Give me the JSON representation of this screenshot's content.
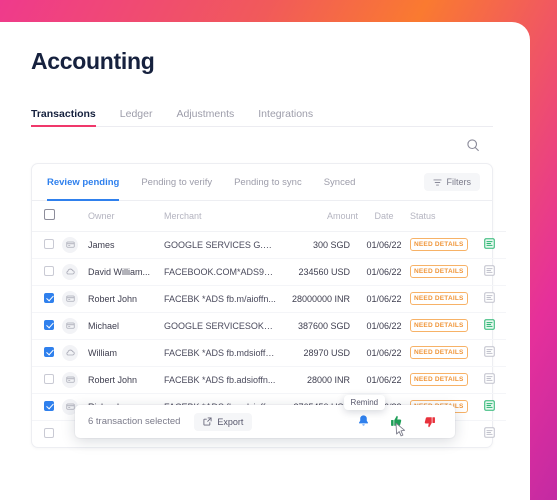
{
  "page": {
    "title": "Accounting"
  },
  "nav_tabs": [
    {
      "label": "Transactions",
      "active": true
    },
    {
      "label": "Ledger",
      "active": false
    },
    {
      "label": "Adjustments",
      "active": false
    },
    {
      "label": "Integrations",
      "active": false
    }
  ],
  "search": {
    "icon": "search-icon"
  },
  "card_tabs": [
    {
      "label": "Review pending",
      "active": true
    },
    {
      "label": "Pending to verify",
      "active": false
    },
    {
      "label": "Pending to sync",
      "active": false
    },
    {
      "label": "Synced",
      "active": false
    }
  ],
  "filters": {
    "label": "Filters",
    "icon": "filter-icon"
  },
  "table": {
    "columns": [
      "",
      "",
      "Owner",
      "Merchant",
      "Amount",
      "Date",
      "Status",
      ""
    ],
    "header_checkbox": false,
    "rows": [
      {
        "checked": false,
        "type": "card-icon",
        "owner": "James",
        "merchant": "GOOGLE SERVICES G.Cui7...",
        "amount": "300 SGD",
        "date": "01/06/22",
        "status": "NEED DETAILS",
        "receipt": "green"
      },
      {
        "checked": false,
        "type": "cloud-icon",
        "owner": "David William...",
        "merchant": "FACEBOOK.COM*ADS989f...",
        "amount": "234560 USD",
        "date": "01/06/22",
        "status": "NEED DETAILS",
        "receipt": "gray"
      },
      {
        "checked": true,
        "type": "card-icon",
        "owner": "Robert John",
        "merchant": "FACEBK *ADS fb.m/aioffn...",
        "amount": "28000000 INR",
        "date": "01/06/22",
        "status": "NEED DETAILS",
        "receipt": "gray"
      },
      {
        "checked": true,
        "type": "card-icon",
        "owner": "Michael",
        "merchant": "GOOGLE SERVICESOKLHlfL...",
        "amount": "387600 SGD",
        "date": "01/06/22",
        "status": "NEED DETAILS",
        "receipt": "green"
      },
      {
        "checked": true,
        "type": "cloud-icon",
        "owner": "William",
        "merchant": "FACEBK *ADS fb.mdsioffn...",
        "amount": "28970 USD",
        "date": "01/06/22",
        "status": "NEED DETAILS",
        "receipt": "gray"
      },
      {
        "checked": false,
        "type": "card-icon",
        "owner": "Robert John",
        "merchant": "FACEBK *ADS fb.adsioffn...",
        "amount": "28000 INR",
        "date": "01/06/22",
        "status": "NEED DETAILS",
        "receipt": "gray"
      },
      {
        "checked": true,
        "type": "card-icon",
        "owner": "Richard",
        "merchant": "FACEBK *ADS fb.mdsioffn...",
        "amount": "2765450 USD",
        "date": "01/06/22",
        "status": "NEED DETAILS",
        "receipt": "green"
      },
      {
        "checked": false,
        "type": "card-icon",
        "owner": "",
        "merchant": "",
        "amount": "",
        "date": "",
        "status": "",
        "receipt": "gray"
      }
    ]
  },
  "selection_bar": {
    "count_label": "6 transaction selected",
    "export_label": "Export",
    "export_icon": "external-link-icon",
    "actions": [
      {
        "name": "remind-bell-icon",
        "tooltip": "Remind"
      },
      {
        "name": "thumbs-up-icon",
        "tooltip": ""
      },
      {
        "name": "thumbs-down-icon",
        "tooltip": ""
      }
    ]
  },
  "colors": {
    "accent_pink": "#f0386b",
    "accent_blue": "#2f80ed",
    "badge_orange": "#f0963a",
    "receipt_green": "#2bb673",
    "bell_blue": "#2f80ed",
    "thumb_up_green": "#1e9e57",
    "thumb_down_red": "#e8323c"
  }
}
